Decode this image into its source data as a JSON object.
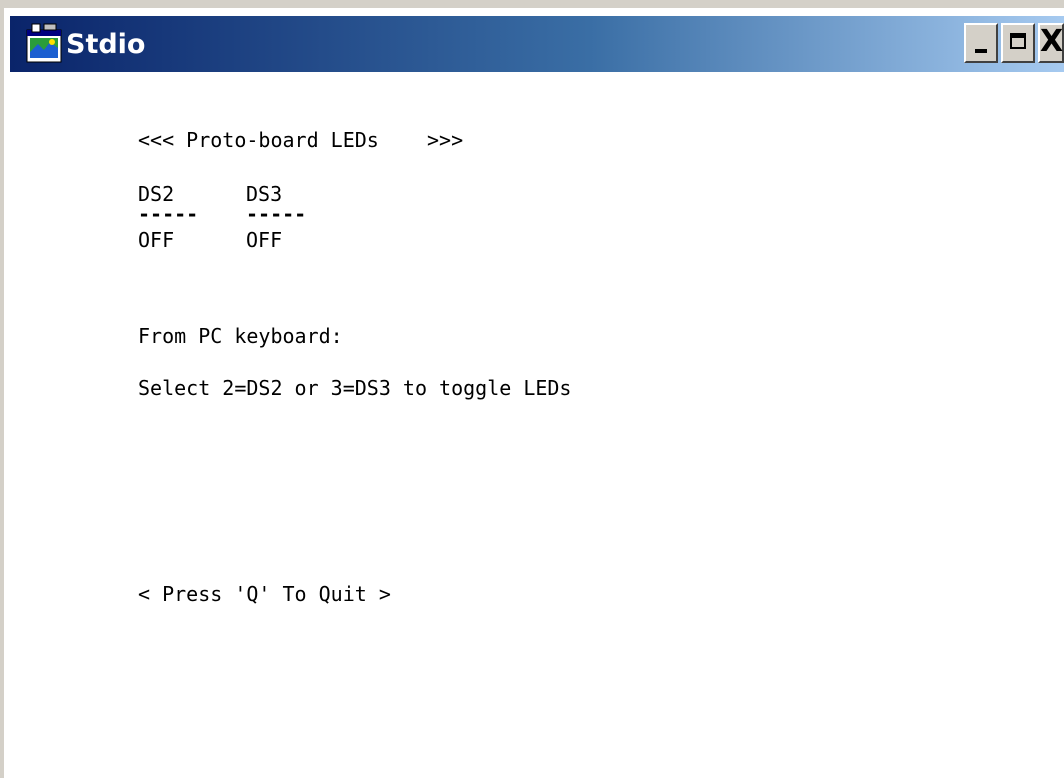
{
  "window": {
    "title": "Stdio",
    "icon": "console-app-icon",
    "controls": {
      "minimize": "minimize-icon",
      "maximize": "maximize-icon",
      "close": "X"
    }
  },
  "console": {
    "header": "<<< Proto-board LEDs    >>>",
    "leds": [
      {
        "name": "DS2",
        "underline": "-----",
        "state": "OFF"
      },
      {
        "name": "DS3",
        "underline": "-----",
        "state": "OFF"
      }
    ],
    "instructions_title": "From PC keyboard:",
    "instructions": "Select 2=DS2 or 3=DS3 to toggle LEDs",
    "quit_prompt": "< Press 'Q' To Quit >"
  }
}
